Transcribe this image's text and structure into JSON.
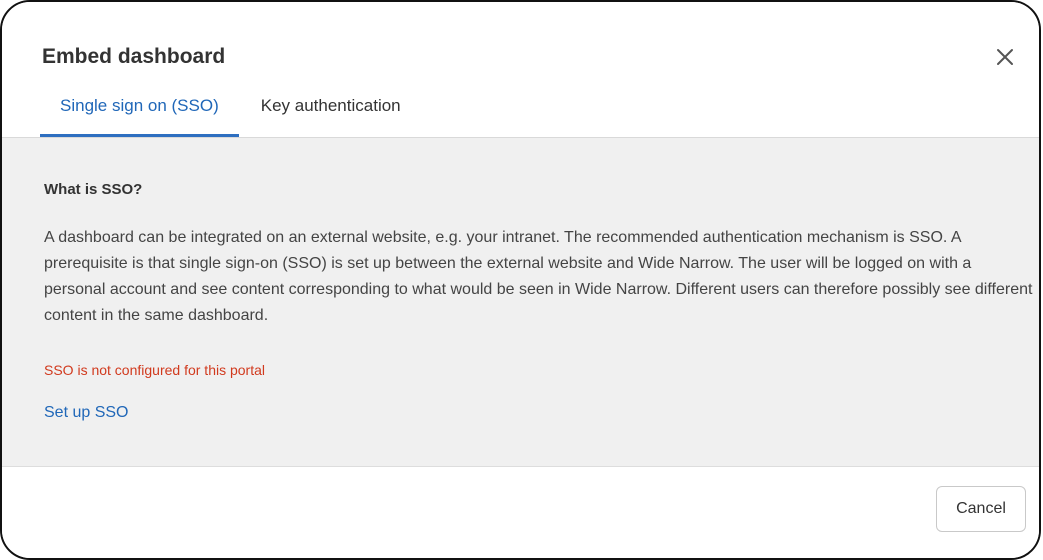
{
  "dialog": {
    "title": "Embed dashboard",
    "close_icon": "close-icon"
  },
  "tabs": [
    {
      "label": "Single sign on (SSO)",
      "active": true
    },
    {
      "label": "Key authentication",
      "active": false
    }
  ],
  "content": {
    "heading": "What is SSO?",
    "description": "A dashboard can be integrated on an external website, e.g. your intranet. The recommended authentication mechanism is SSO. A prerequisite is that single sign-on (SSO) is set up between the external website and Wide Narrow. The user will be logged on with a personal account and see content corresponding to what would be seen in Wide Narrow. Different users can therefore possibly see different content in the same dashboard.",
    "status_message": "SSO is not configured for this portal",
    "setup_link": "Set up SSO"
  },
  "footer": {
    "cancel_label": "Cancel"
  },
  "colors": {
    "accent": "#2067b8",
    "error": "#d13a1e",
    "panel_background": "#f0f0f0"
  }
}
